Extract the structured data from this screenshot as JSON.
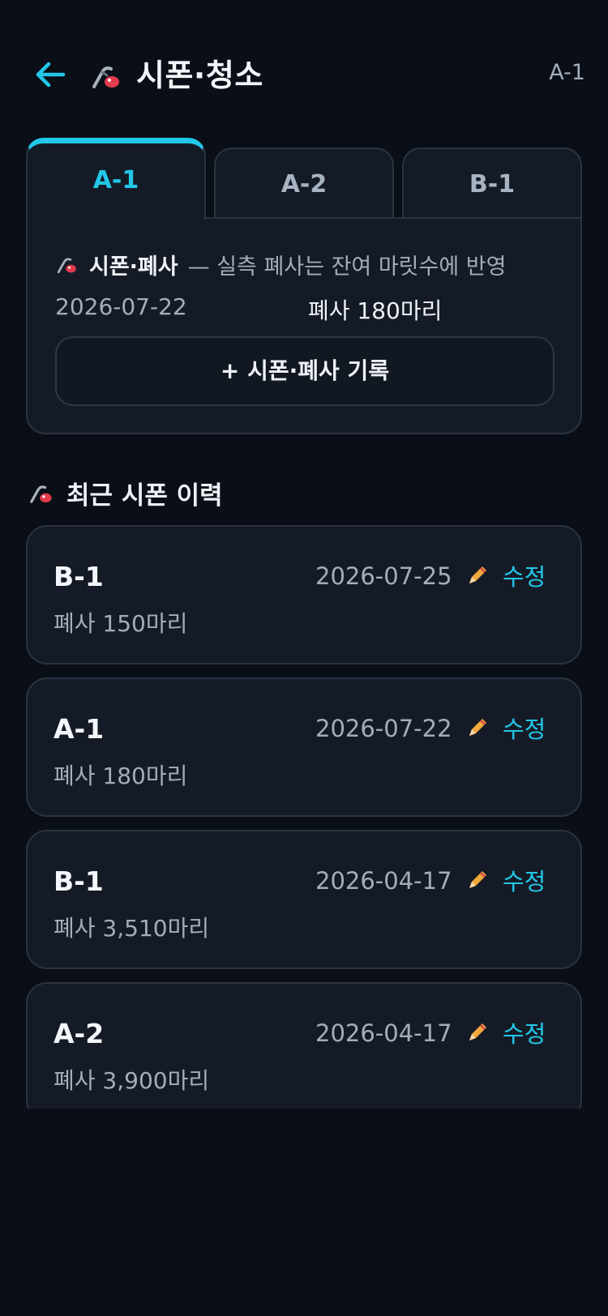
{
  "header": {
    "title": "시폰·청소",
    "badge": "A-1",
    "back_icon": "arrow-left-icon",
    "title_icon": "siphon-icon"
  },
  "tabs": [
    {
      "label": "A-1",
      "active": true
    },
    {
      "label": "A-2",
      "active": false
    },
    {
      "label": "B-1",
      "active": false
    }
  ],
  "panel": {
    "title": "시폰·폐사",
    "description": "— 실측 폐사는 잔여 마릿수에 반영",
    "date": "2026-07-22",
    "count": "폐사 180마리",
    "record_button": "+  시폰·폐사 기록"
  },
  "recent": {
    "title": "최근 시폰 이력",
    "items": [
      {
        "site": "B-1",
        "date": "2026-07-25",
        "count": "폐사 150마리",
        "edit_label": "수정"
      },
      {
        "site": "A-1",
        "date": "2026-07-22",
        "count": "폐사 180마리",
        "edit_label": "수정"
      },
      {
        "site": "B-1",
        "date": "2026-04-17",
        "count": "폐사 3,510마리",
        "edit_label": "수정"
      },
      {
        "site": "A-2",
        "date": "2026-04-17",
        "count": "폐사 3,900마리",
        "edit_label": "수정"
      }
    ]
  },
  "colors": {
    "background": "#0a0e16",
    "card": "#151b26",
    "accent": "#22c7e8",
    "muted_text": "#a3adbb"
  }
}
